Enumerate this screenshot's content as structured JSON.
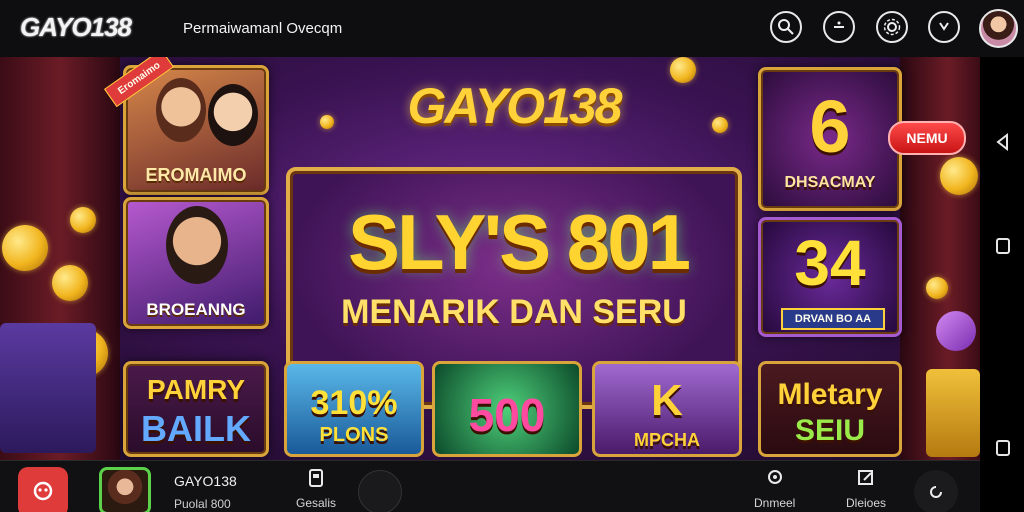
{
  "header": {
    "logo": "GAYO138",
    "nav_label": "Permaiwamanl Ovecqm",
    "icons": [
      "search-icon",
      "minus-icon",
      "settings-icon",
      "clock-icon",
      "avatar"
    ]
  },
  "stage": {
    "brand_title": "GAYO138",
    "center": {
      "headline": "SLY'S 801",
      "subtitle": "MENARIK DAN SERU"
    },
    "left_tiles": [
      {
        "caption": "EROMAIMO",
        "ribbon": "Eromaimo"
      },
      {
        "caption": "BROEANNG"
      },
      {
        "line1": "PAMRY",
        "line2": "BAILK"
      }
    ],
    "bottom_tiles": [
      {
        "line1": "310%",
        "line2": "PLONS"
      },
      {
        "line1": "500"
      },
      {
        "line1": "K",
        "line2": "MPCHA"
      },
      {
        "line1": "Mletary",
        "line2": "SEIU"
      }
    ],
    "right_tiles": [
      {
        "number": "6",
        "caption": "DHSACMAY"
      },
      {
        "number": "34",
        "caption": "DRVAN BO AA"
      }
    ],
    "promo_button": "NEMU"
  },
  "bottom_bar": {
    "title": "GAYO138",
    "subtitle": "Puolal 800",
    "items": [
      {
        "label": "Gesalis",
        "icon": "tablet-icon"
      },
      {
        "label": "Dnmeel",
        "icon": "chat-icon"
      },
      {
        "label": "Dleioes",
        "icon": "edit-icon"
      }
    ]
  },
  "system_nav": [
    "back-icon",
    "home-icon",
    "recents-icon"
  ],
  "colors": {
    "accent_red": "#e03b3b",
    "gold": "#ffd23a",
    "purple_bg": "#3a1352"
  }
}
